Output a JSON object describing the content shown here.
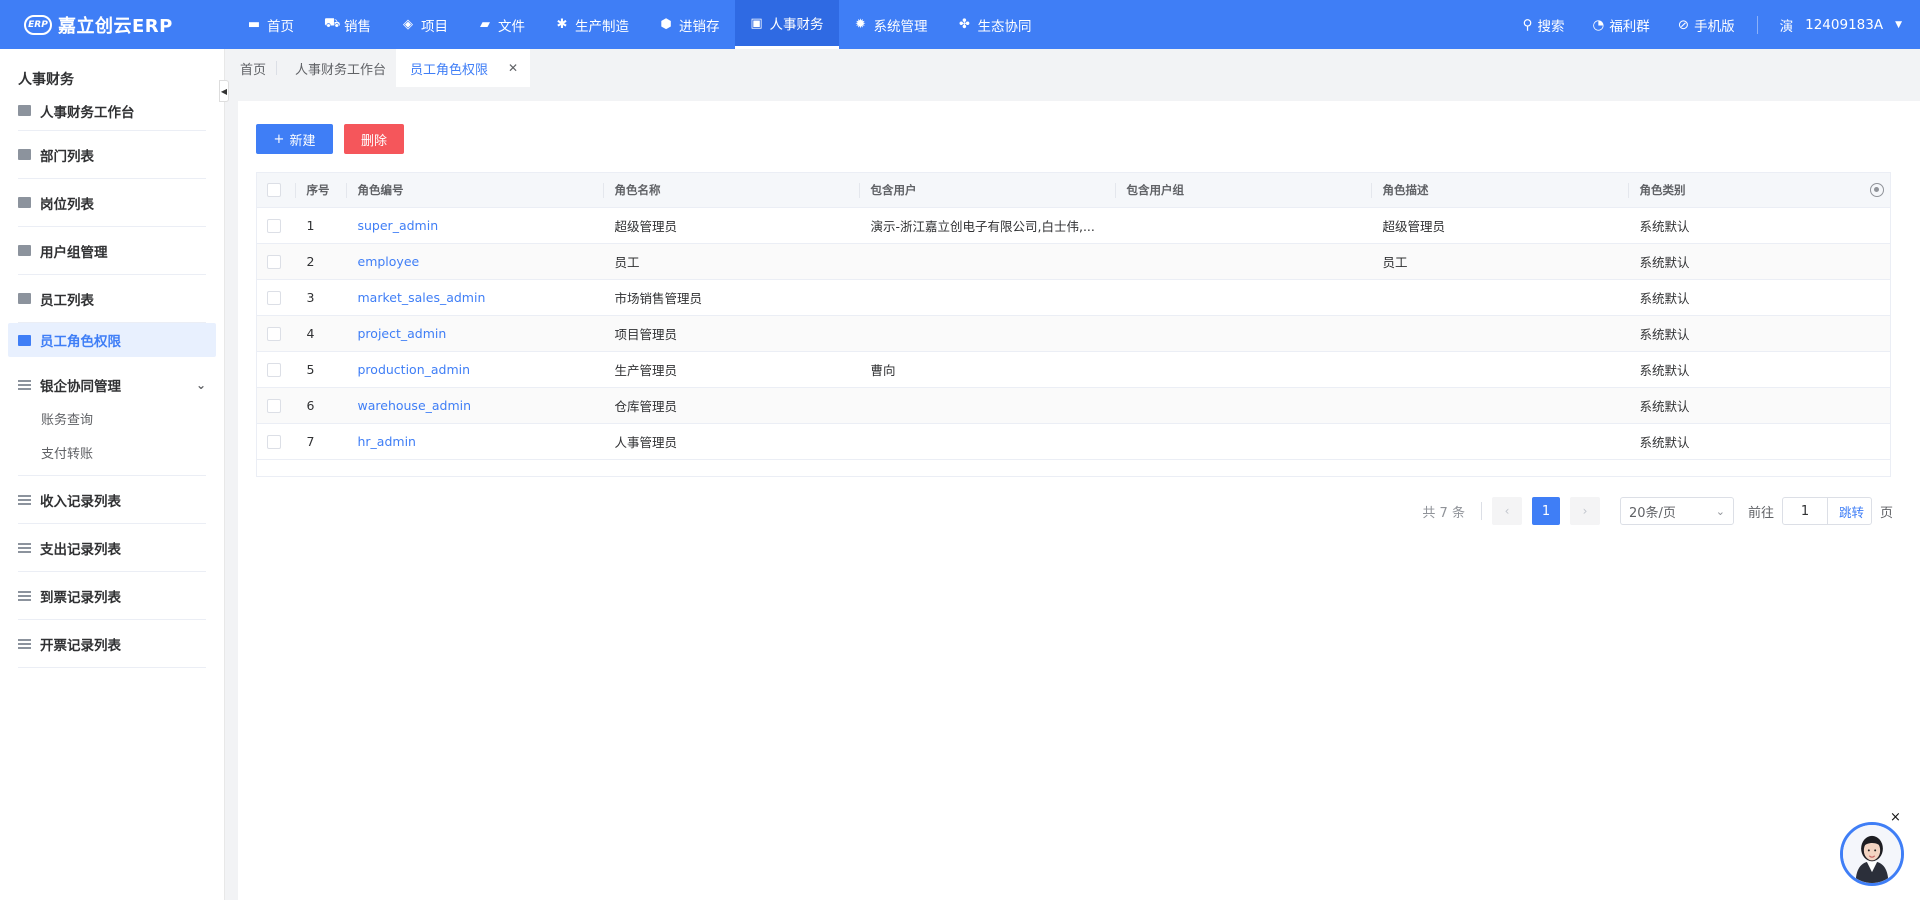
{
  "brand": {
    "logo_mark": "ERP",
    "name": "嘉立创云ERP"
  },
  "nav": [
    {
      "label": "首页",
      "icon": "monitor-icon",
      "glyph": "▬",
      "active": false
    },
    {
      "label": "销售",
      "icon": "cart-icon",
      "glyph": "⛟",
      "active": false
    },
    {
      "label": "项目",
      "icon": "layers-icon",
      "glyph": "◈",
      "active": false
    },
    {
      "label": "文件",
      "icon": "folder-icon",
      "glyph": "▰",
      "active": false
    },
    {
      "label": "生产制造",
      "icon": "gear-icon",
      "glyph": "✱",
      "active": false
    },
    {
      "label": "进销存",
      "icon": "box-icon",
      "glyph": "⬢",
      "active": false
    },
    {
      "label": "人事财务",
      "icon": "id-card-icon",
      "glyph": "▣",
      "active": true
    },
    {
      "label": "系统管理",
      "icon": "settings-icon",
      "glyph": "✹",
      "active": false
    },
    {
      "label": "生态协同",
      "icon": "cluster-icon",
      "glyph": "✤",
      "active": false
    }
  ],
  "top_right": {
    "search": "搜索",
    "welfare": "福利群",
    "mobile": "手机版",
    "user_initial": "演",
    "user_id": "12409183A"
  },
  "sidebar": {
    "title": "人事财务",
    "items": [
      {
        "label": "人事财务工作台",
        "icon": "dashboard-icon",
        "active": false
      },
      {
        "label": "部门列表",
        "icon": "department-icon",
        "active": false
      },
      {
        "label": "岗位列表",
        "icon": "position-icon",
        "active": false
      },
      {
        "label": "用户组管理",
        "icon": "user-group-icon",
        "active": false
      },
      {
        "label": "员工列表",
        "icon": "employee-icon",
        "active": false
      },
      {
        "label": "员工角色权限",
        "icon": "shield-icon",
        "active": true
      }
    ],
    "group": {
      "label": "银企协同管理",
      "children": [
        "账务查询",
        "支付转账"
      ]
    },
    "more": [
      "收入记录列表",
      "支出记录列表",
      "到票记录列表",
      "开票记录列表"
    ]
  },
  "tabs": [
    {
      "label": "首页",
      "active": false
    },
    {
      "label": "人事财务工作台",
      "active": false
    },
    {
      "label": "员工角色权限",
      "active": true
    }
  ],
  "toolbar": {
    "new_label": "新建",
    "delete_label": "删除"
  },
  "table": {
    "columns": [
      "序号",
      "角色编号",
      "角色名称",
      "包含用户",
      "包含用户组",
      "角色描述",
      "角色类别"
    ],
    "rows": [
      {
        "no": "1",
        "code": "super_admin",
        "name": "超级管理员",
        "users": "演示-浙江嘉立创电子有限公司,白士伟,...",
        "groups": "",
        "desc": "超级管理员",
        "type": "系统默认"
      },
      {
        "no": "2",
        "code": "employee",
        "name": "员工",
        "users": "",
        "groups": "",
        "desc": "员工",
        "type": "系统默认"
      },
      {
        "no": "3",
        "code": "market_sales_admin",
        "name": "市场销售管理员",
        "users": "",
        "groups": "",
        "desc": "",
        "type": "系统默认"
      },
      {
        "no": "4",
        "code": "project_admin",
        "name": "项目管理员",
        "users": "",
        "groups": "",
        "desc": "",
        "type": "系统默认"
      },
      {
        "no": "5",
        "code": "production_admin",
        "name": "生产管理员",
        "users": "曹向",
        "groups": "",
        "desc": "",
        "type": "系统默认"
      },
      {
        "no": "6",
        "code": "warehouse_admin",
        "name": "仓库管理员",
        "users": "",
        "groups": "",
        "desc": "",
        "type": "系统默认"
      },
      {
        "no": "7",
        "code": "hr_admin",
        "name": "人事管理员",
        "users": "",
        "groups": "",
        "desc": "",
        "type": "系统默认"
      }
    ]
  },
  "pagination": {
    "total": "共 7 条",
    "current_page": "1",
    "page_size": "20条/页",
    "goto_prefix": "前往",
    "goto_value": "1",
    "jump": "跳转",
    "goto_suffix": "页"
  },
  "chat": {
    "close": "×"
  }
}
